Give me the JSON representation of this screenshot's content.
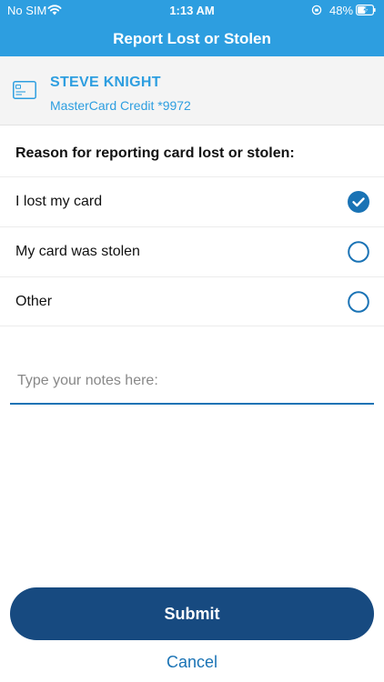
{
  "status_bar": {
    "carrier": "No SIM",
    "time": "1:13 AM",
    "battery": "48%",
    "wifi_icon": "wifi-icon",
    "orientation_icon": "orientation-lock-icon",
    "battery_icon": "battery-charging-icon"
  },
  "header": {
    "title": "Report Lost or Stolen",
    "background": "#2d9ee0"
  },
  "card": {
    "name": "STEVE KNIGHT",
    "description": "MasterCard Credit *9972",
    "icon": "credit-card-icon",
    "accent": "#2d9ee0"
  },
  "reason": {
    "heading": "Reason for reporting card lost or stolen:",
    "options": [
      {
        "label": "I lost my card",
        "selected": true
      },
      {
        "label": "My card was stolen",
        "selected": false
      },
      {
        "label": "Other",
        "selected": false
      }
    ]
  },
  "notes": {
    "placeholder": "Type your notes here:",
    "value": ""
  },
  "actions": {
    "submit_label": "Submit",
    "cancel_label": "Cancel",
    "submit_color": "#174a80",
    "link_color": "#1a73b5"
  }
}
